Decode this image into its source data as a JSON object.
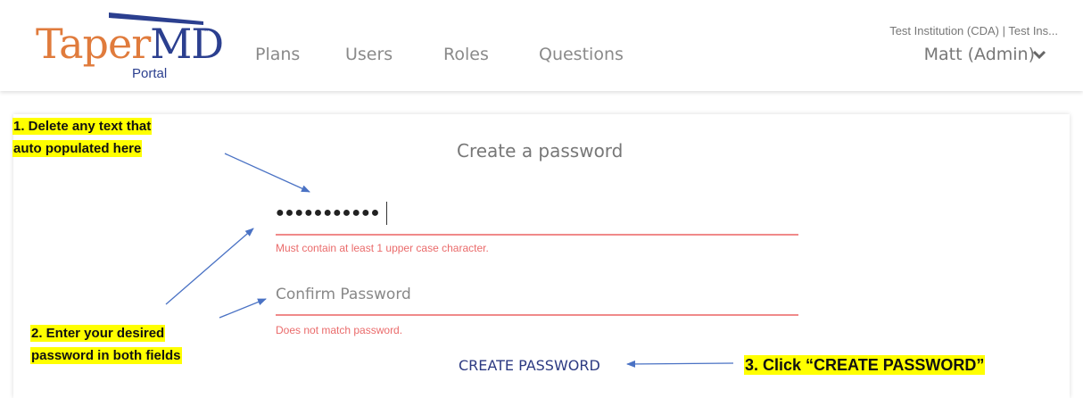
{
  "header": {
    "logo": {
      "taper": "Taper",
      "md": "MD",
      "tm": "™",
      "portal": "Portal"
    },
    "nav": [
      "Plans",
      "Users",
      "Roles",
      "Questions"
    ],
    "institution": "Test Institution (CDA)  |  Test Ins...",
    "user": "Matt (Admin)",
    "chevron_icon": "chevron-down-icon"
  },
  "form": {
    "title": "Create a password",
    "password_value": "●●●●●●●●●●●",
    "password_error": "Must contain at least 1 upper case character.",
    "confirm_placeholder": "Confirm Password",
    "confirm_error": "Does not match password.",
    "submit_label": "CREATE PASSWORD"
  },
  "annotations": {
    "step1_line1": "1. Delete any text that",
    "step1_line2": "auto populated here",
    "step2_line1": "2. Enter your desired",
    "step2_line2": "password in both fields",
    "step3": "3. Click “CREATE PASSWORD”"
  },
  "colors": {
    "brand_orange": "#e07b3c",
    "brand_blue": "#2b3f8f",
    "error_red": "#ea6b6b",
    "highlight_yellow": "#ffff00",
    "arrow_blue": "#4a72c4"
  }
}
